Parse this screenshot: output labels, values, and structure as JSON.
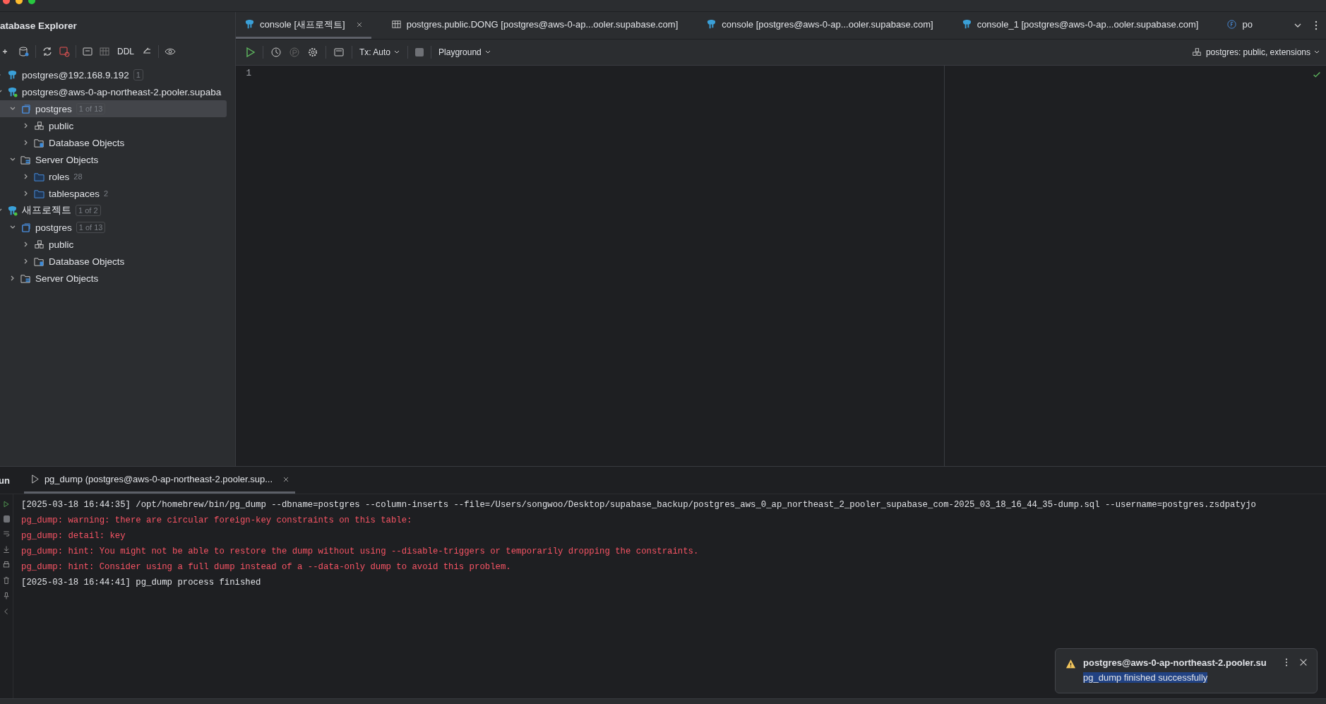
{
  "explorer": {
    "title": "atabase Explorer",
    "toolbar_label": "DDL",
    "tree": [
      {
        "kind": "connection",
        "label": "postgres@192.168.9.192",
        "badge": "1",
        "online": false,
        "expanded": false,
        "selected": false
      },
      {
        "kind": "connection",
        "label": "postgres@aws-0-ap-northeast-2.pooler.supaba",
        "online": true,
        "expanded": true,
        "selected": false,
        "children": [
          {
            "kind": "database",
            "label": "postgres",
            "badge": "1 of 13",
            "expanded": true,
            "selected": true,
            "children": [
              {
                "kind": "schema",
                "label": "public",
                "expanded": false,
                "selected": false
              },
              {
                "kind": "db_objects",
                "label": "Database Objects",
                "expanded": false,
                "selected": false
              }
            ]
          },
          {
            "kind": "server_objects",
            "label": "Server Objects",
            "expanded": true,
            "selected": false,
            "children": [
              {
                "kind": "folder",
                "label": "roles",
                "count": "28",
                "expanded": false,
                "selected": false
              },
              {
                "kind": "folder",
                "label": "tablespaces",
                "count": "2",
                "expanded": false,
                "selected": false
              }
            ]
          }
        ]
      },
      {
        "kind": "connection",
        "label": "새프로젝트",
        "badge": "1 of 2",
        "online": true,
        "expanded": true,
        "selected": false,
        "children": [
          {
            "kind": "database",
            "label": "postgres",
            "badge": "1 of 13",
            "expanded": true,
            "selected": false,
            "children": [
              {
                "kind": "schema",
                "label": "public",
                "expanded": false,
                "selected": false
              },
              {
                "kind": "db_objects",
                "label": "Database Objects",
                "expanded": false,
                "selected": false
              }
            ]
          },
          {
            "kind": "server_objects",
            "label": "Server Objects",
            "expanded": false,
            "selected": false
          }
        ]
      }
    ]
  },
  "tabs": [
    {
      "kind": "console",
      "label": "console [새프로젝트]",
      "selected": true,
      "closable": true
    },
    {
      "kind": "table",
      "label": "postgres.public.DONG [postgres@aws-0-ap...ooler.supabase.com]",
      "selected": false,
      "closable": false
    },
    {
      "kind": "console",
      "label": "console [postgres@aws-0-ap...ooler.supabase.com]",
      "selected": false,
      "closable": false
    },
    {
      "kind": "console",
      "label": "console_1 [postgres@aws-0-ap...ooler.supabase.com]",
      "selected": false,
      "closable": false
    },
    {
      "kind": "function",
      "label": "po",
      "selected": false,
      "closable": false
    }
  ],
  "editor": {
    "tx_mode": "Tx: Auto",
    "session_mode": "Playground",
    "schema": "postgres: public, extensions",
    "line_numbers": [
      "1"
    ]
  },
  "run_panel": {
    "title": "un",
    "tabs": [
      {
        "label": "pg_dump (postgres@aws-0-ap-northeast-2.pooler.sup...",
        "selected": true
      }
    ],
    "lines": [
      {
        "kind": "info",
        "text": "[2025-03-18 16:44:35] /opt/homebrew/bin/pg_dump --dbname=postgres --column-inserts --file=/Users/songwoo/Desktop/supabase_backup/postgres_aws_0_ap_northeast_2_pooler_supabase_com-2025_03_18_16_44_35-dump.sql --username=postgres.zsdpatyjo"
      },
      {
        "kind": "error",
        "text": "pg_dump: warning: there are circular foreign-key constraints on this table:"
      },
      {
        "kind": "error",
        "text": "pg_dump: detail: key"
      },
      {
        "kind": "error",
        "text": "pg_dump: hint: You might not be able to restore the dump without using --disable-triggers or temporarily dropping the constraints."
      },
      {
        "kind": "error",
        "text": "pg_dump: hint: Consider using a full dump instead of a --data-only dump to avoid this problem."
      },
      {
        "kind": "info",
        "text": "[2025-03-18 16:44:41] pg_dump process finished"
      }
    ]
  },
  "notification": {
    "title": "postgres@aws-0-ap-northeast-2.pooler.su",
    "message": "pg_dump finished successfully",
    "message_highlighted": true
  }
}
